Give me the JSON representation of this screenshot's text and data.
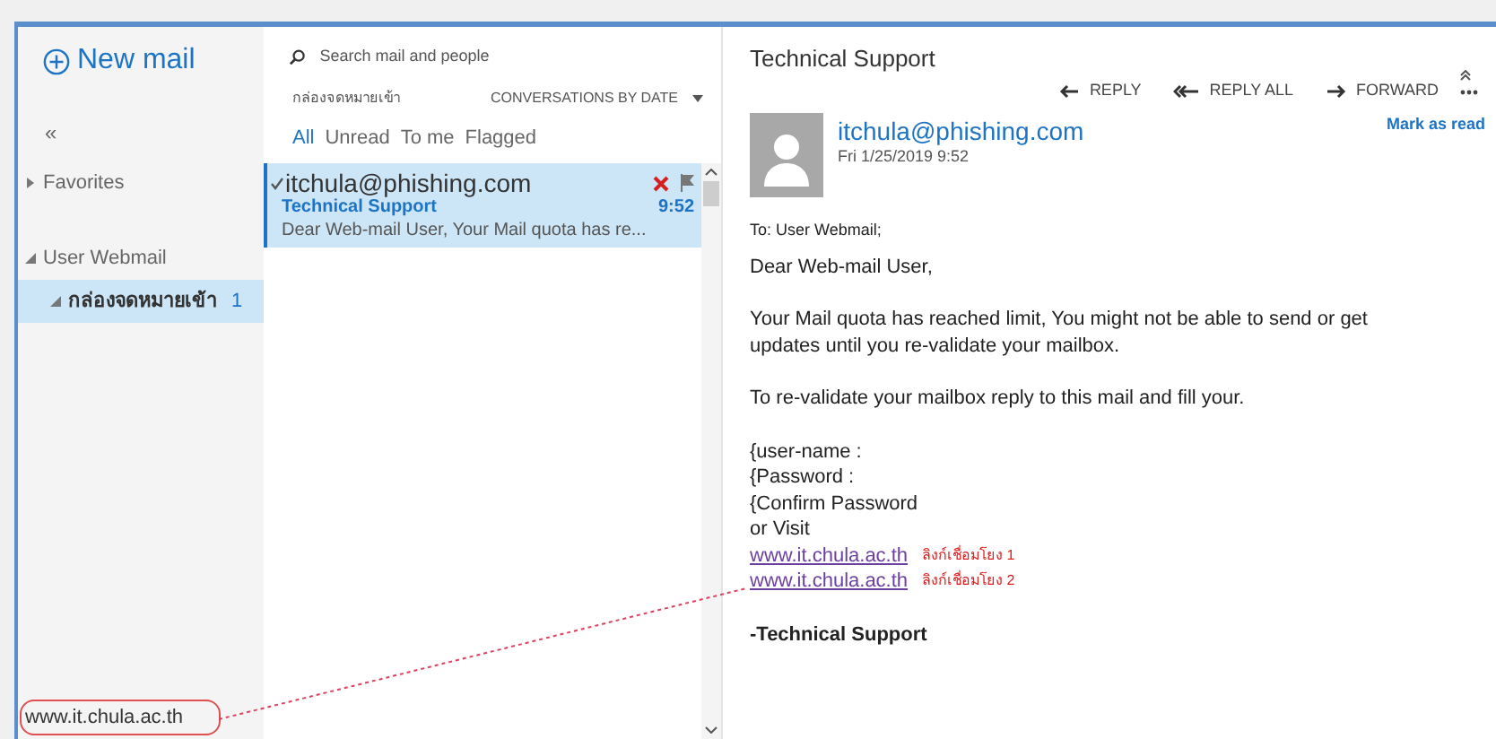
{
  "new_mail": "New mail",
  "collapse": "«",
  "folders": [
    {
      "label": "Favorites",
      "expanded": false,
      "selected": false
    },
    {
      "label": "User  Webmail",
      "expanded": true,
      "selected": false,
      "children": [
        {
          "label": "กล่องจดหมายเข้า",
          "count": "1",
          "expanded": true,
          "selected": true
        }
      ]
    }
  ],
  "search": {
    "placeholder": "Search mail and people"
  },
  "folder_title": "กล่องจดหมายเข้า",
  "sort": "CONVERSATIONS BY DATE",
  "filters": [
    {
      "label": "All",
      "selected": true
    },
    {
      "label": "Unread",
      "selected": false
    },
    {
      "label": "To me",
      "selected": false
    },
    {
      "label": "Flagged",
      "selected": false
    }
  ],
  "messages": [
    {
      "sender": "itchula@phishing.com",
      "subject": "Technical Support",
      "preview": "Dear Web-mail User, Your Mail quota has re...",
      "time": "9:52",
      "selected": true
    }
  ],
  "reading": {
    "title": "Technical Support",
    "actions": [
      {
        "label": "REPLY",
        "kind": "reply"
      },
      {
        "label": "REPLY ALL",
        "kind": "reply_all"
      },
      {
        "label": "FORWARD",
        "kind": "forward"
      }
    ],
    "sender": "itchula@phishing.com",
    "date": "Fri 1/25/2019 9:52",
    "mark_read": "Mark as read",
    "to": "To: User  Webmail;",
    "paragraphs": [
      [
        {
          "kind": "text",
          "text": "Dear Web-mail User,"
        }
      ],
      [
        {
          "kind": "text",
          "text": "Your Mail quota has reached limit, You might not be able to send or get updates until you re-validate your mailbox."
        }
      ],
      [
        {
          "kind": "text",
          "text": "To re-validate your mailbox reply to this mail and fill your."
        }
      ],
      [
        {
          "kind": "text",
          "text": "{user-name :"
        },
        {
          "kind": "text",
          "text": "{Password :"
        },
        {
          "kind": "text",
          "text": "{Confirm Password"
        },
        {
          "kind": "text",
          "text": "or Visit"
        },
        {
          "kind": "link",
          "text": "www.it.chula.ac.th",
          "note": "ลิงก์เชื่อมโยง 1"
        },
        {
          "kind": "link",
          "text": "www.it.chula.ac.th",
          "note": "ลิงก์เชื่อมโยง 2"
        }
      ],
      [
        {
          "kind": "signature",
          "text": "-Technical Support"
        }
      ]
    ]
  },
  "status_url": "www.it.chula.ac.th"
}
